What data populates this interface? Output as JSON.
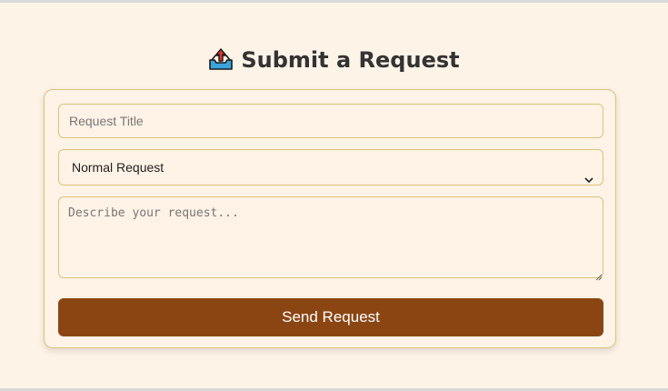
{
  "heading": {
    "icon": "outbox-tray-icon",
    "title": "Submit a Request"
  },
  "form": {
    "title_input": {
      "placeholder": "Request Title",
      "value": ""
    },
    "request_type": {
      "selected": "Normal Request"
    },
    "description": {
      "placeholder": "Describe your request...",
      "value": ""
    },
    "submit_label": "Send Request"
  },
  "colors": {
    "page_background": "#fdf3e7",
    "card_border": "#dcc27a",
    "button": "#8b4513",
    "button_text": "#ffffff",
    "heading_text": "#333333"
  }
}
